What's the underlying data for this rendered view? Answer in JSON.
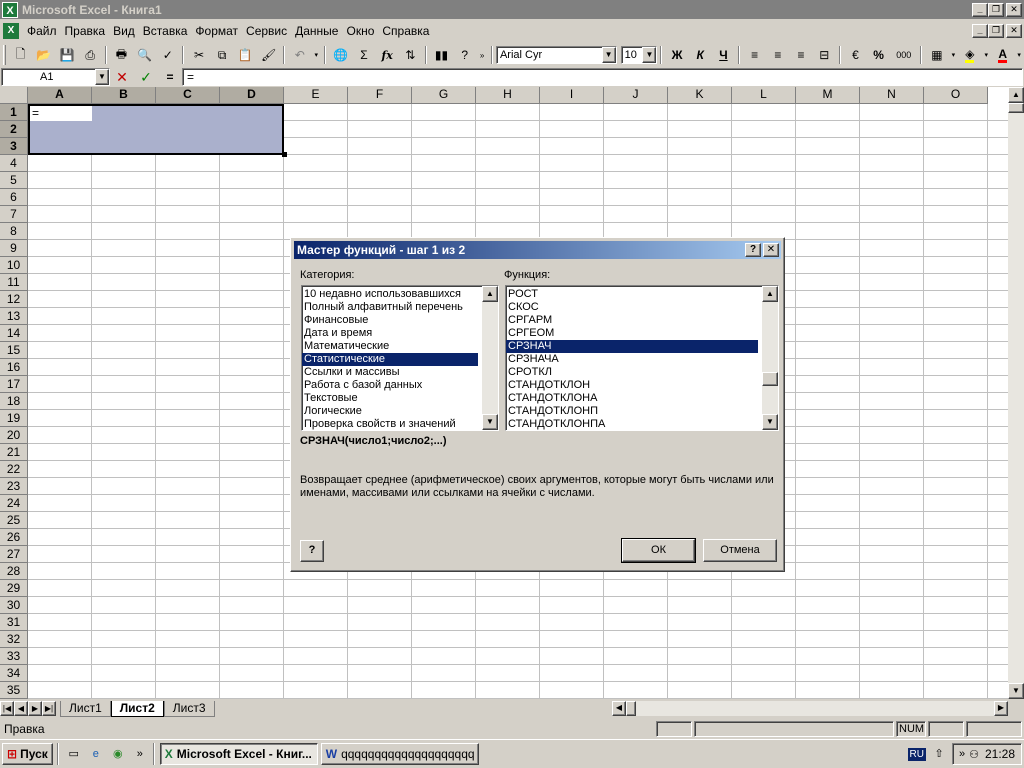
{
  "window": {
    "title": "Microsoft Excel - Книга1"
  },
  "menu": [
    "Файл",
    "Правка",
    "Вид",
    "Вставка",
    "Формат",
    "Сервис",
    "Данные",
    "Окно",
    "Справка"
  ],
  "toolbar": {
    "font_name": "Arial Cyr",
    "font_size": "10",
    "bold": "Ж",
    "italic": "К",
    "underline": "Ч",
    "percent": "%",
    "thousands": "000",
    "sigma": "Σ",
    "fx": "fx"
  },
  "formula_bar": {
    "name_box": "A1",
    "equals": "=",
    "content": "="
  },
  "grid": {
    "columns": [
      "A",
      "B",
      "C",
      "D",
      "E",
      "F",
      "G",
      "H",
      "I",
      "J",
      "K",
      "L",
      "M",
      "N",
      "O"
    ],
    "rows": [
      "1",
      "2",
      "3",
      "4",
      "5",
      "6",
      "7",
      "8",
      "9",
      "10",
      "11",
      "12",
      "13",
      "14",
      "15",
      "16",
      "17",
      "18",
      "19",
      "20",
      "21",
      "22",
      "23",
      "24",
      "25",
      "26",
      "27",
      "28",
      "29",
      "30",
      "31",
      "32",
      "33",
      "34",
      "35"
    ],
    "cell_a1": "=",
    "selection": "A1:D3"
  },
  "sheet_tabs": [
    "Лист1",
    "Лист2",
    "Лист3"
  ],
  "active_tab": "Лист2",
  "status": {
    "mode": "Правка",
    "num": "NUM"
  },
  "taskbar": {
    "start": "Пуск",
    "tasks": [
      "Microsoft Excel - Книг...",
      "qqqqqqqqqqqqqqqqqqqqq..."
    ],
    "lang": "RU",
    "time": "21:28",
    "chevron": "»"
  },
  "dialog": {
    "title": "Мастер функций - шаг 1 из 2",
    "help_btn": "?",
    "close_btn": "✕",
    "category_label": "Категория:",
    "function_label": "Функция:",
    "categories": [
      "10 недавно использовавшихся",
      "Полный алфавитный перечень",
      "Финансовые",
      "Дата и время",
      "Математические",
      "Статистические",
      "Ссылки и массивы",
      "Работа с базой данных",
      "Текстовые",
      "Логические",
      "Проверка свойств и значений"
    ],
    "selected_category": "Статистические",
    "functions": [
      "РОСТ",
      "СКОС",
      "СРГАРМ",
      "СРГЕОМ",
      "СРЗНАЧ",
      "СРЗНАЧА",
      "СРОТКЛ",
      "СТАНДОТКЛОН",
      "СТАНДОТКЛОНА",
      "СТАНДОТКЛОНП",
      "СТАНДОТКЛОНПА"
    ],
    "selected_function": "СРЗНАЧ",
    "signature": "СРЗНАЧ(число1;число2;...)",
    "description": "Возвращает среднее (арифметическое) своих аргументов, которые могут быть числами или именами, массивами или ссылками на ячейки с числами.",
    "ok": "ОК",
    "cancel": "Отмена"
  }
}
